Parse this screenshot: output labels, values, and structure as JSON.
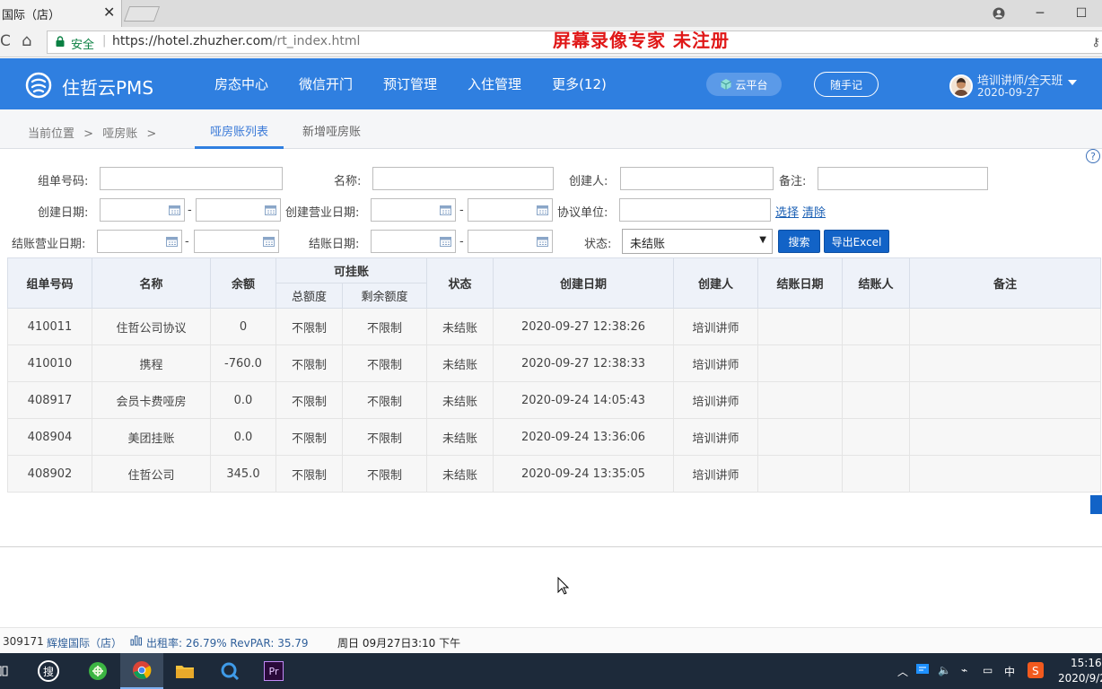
{
  "browser": {
    "tab_title": "国际（店）",
    "url_host": "https://hotel.zhuzher.com",
    "url_path": "/rt_index.html",
    "secure_label": "安全",
    "overlay_watermark": "屏幕录像专家  未注册"
  },
  "header": {
    "brand": "住哲云PMS",
    "nav": [
      "房态中心",
      "微信开门",
      "预订管理",
      "入住管理",
      "更多(12)"
    ],
    "cloud_button": "云平台",
    "notes_button": "随手记",
    "user_name": "培训讲师/全天班",
    "user_date": "2020-09-27"
  },
  "subnav": {
    "breadcrumb_label": "当前位置",
    "breadcrumb_sep": ">",
    "breadcrumb_current": "哑房账",
    "tabs": [
      "哑房账列表",
      "新增哑房账"
    ]
  },
  "filters": {
    "group_no_label": "组单号码:",
    "name_label": "名称:",
    "creator_label": "创建人:",
    "remark_label": "备注:",
    "create_date_label": "创建日期:",
    "create_biz_date_label": "创建营业日期:",
    "agreement_label": "协议单位:",
    "select_link": "选择",
    "clear_link": "清除",
    "settle_biz_date_label": "结账营业日期:",
    "settle_date_label": "结账日期:",
    "status_label": "状态:",
    "status_value": "未结账",
    "search_button": "搜索",
    "export_button": "导出Excel",
    "range_dash": "-"
  },
  "table": {
    "headers": {
      "group_no": "组单号码",
      "name": "名称",
      "balance": "余额",
      "credit": "可挂账",
      "credit_total": "总额度",
      "credit_remaining": "剩余额度",
      "status": "状态",
      "created": "创建日期",
      "creator": "创建人",
      "settle_date": "结账日期",
      "settler": "结账人",
      "remark": "备注"
    },
    "rows": [
      {
        "group_no": "410011",
        "name": "住哲公司协议",
        "balance": "0",
        "total": "不限制",
        "remaining": "不限制",
        "status": "未结账",
        "created": "2020-09-27 12:38:26",
        "creator": "培训讲师",
        "settle_date": "",
        "settler": "",
        "remark": ""
      },
      {
        "group_no": "410010",
        "name": "携程",
        "balance": "-760.0",
        "total": "不限制",
        "remaining": "不限制",
        "status": "未结账",
        "created": "2020-09-27 12:38:33",
        "creator": "培训讲师",
        "settle_date": "",
        "settler": "",
        "remark": ""
      },
      {
        "group_no": "408917",
        "name": "会员卡费哑房",
        "balance": "0.0",
        "total": "不限制",
        "remaining": "不限制",
        "status": "未结账",
        "created": "2020-09-24 14:05:43",
        "creator": "培训讲师",
        "settle_date": "",
        "settler": "",
        "remark": ""
      },
      {
        "group_no": "408904",
        "name": "美团挂账",
        "balance": "0.0",
        "total": "不限制",
        "remaining": "不限制",
        "status": "未结账",
        "created": "2020-09-24 13:36:06",
        "creator": "培训讲师",
        "settle_date": "",
        "settler": "",
        "remark": ""
      },
      {
        "group_no": "408902",
        "name": "住哲公司",
        "balance": "345.0",
        "total": "不限制",
        "remaining": "不限制",
        "status": "未结账",
        "created": "2020-09-24 13:35:05",
        "creator": "培训讲师",
        "settle_date": "",
        "settler": "",
        "remark": ""
      }
    ]
  },
  "statusbar": {
    "code": "309171",
    "hotel": "辉煌国际（店）",
    "occupancy": "出租率: 26.79%  RevPAR: 35.79",
    "datetime": "周日 09月27日3:10 下午"
  },
  "taskbar": {
    "search_glyph": "搜",
    "ime": "中",
    "clock_time": "15:16",
    "clock_date": "2020/9/2"
  },
  "colors": {
    "header_blue": "#2f7fe0",
    "button_blue": "#1263c7",
    "link_blue": "#1a5fb4",
    "watermark_red": "#e01818"
  }
}
